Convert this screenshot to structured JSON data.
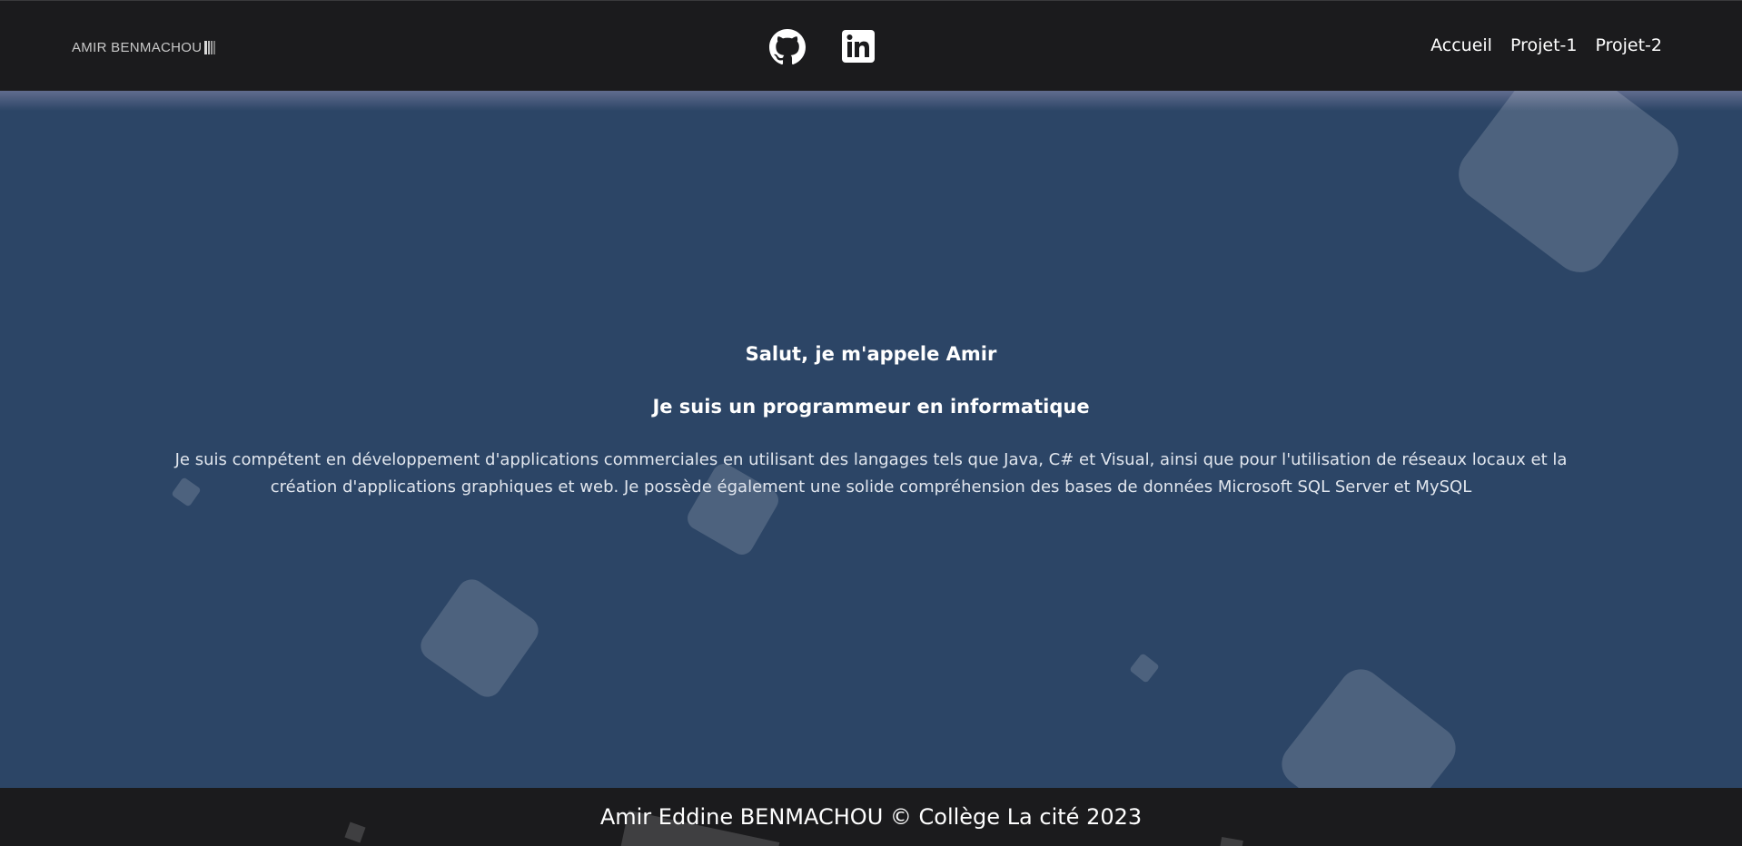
{
  "navbar": {
    "brand": "AMIR BENMACHOU",
    "social": [
      {
        "icon": "github-icon"
      },
      {
        "icon": "linkedin-icon"
      }
    ],
    "links": [
      "Accueil",
      "Projet-1",
      "Projet-2"
    ]
  },
  "hero": {
    "greeting": "Salut, je m'appele Amir",
    "subtitle": "Je suis un programmeur en informatique",
    "description": "Je suis compétent en développement d'applications commerciales en utilisant des langages tels que Java, C# et Visual, ainsi que pour l'utilisation de réseaux locaux et la création d'applications graphiques et web. Je possède également une solide compréhension des bases de données Microsoft SQL Server et MySQL"
  },
  "footer": {
    "text": "Amir Eddine BENMACHOU © Collège La cité 2023"
  },
  "colors": {
    "navbar_bg": "#1b1b1d",
    "page_bg": "#2c4566",
    "text": "#ffffff"
  }
}
